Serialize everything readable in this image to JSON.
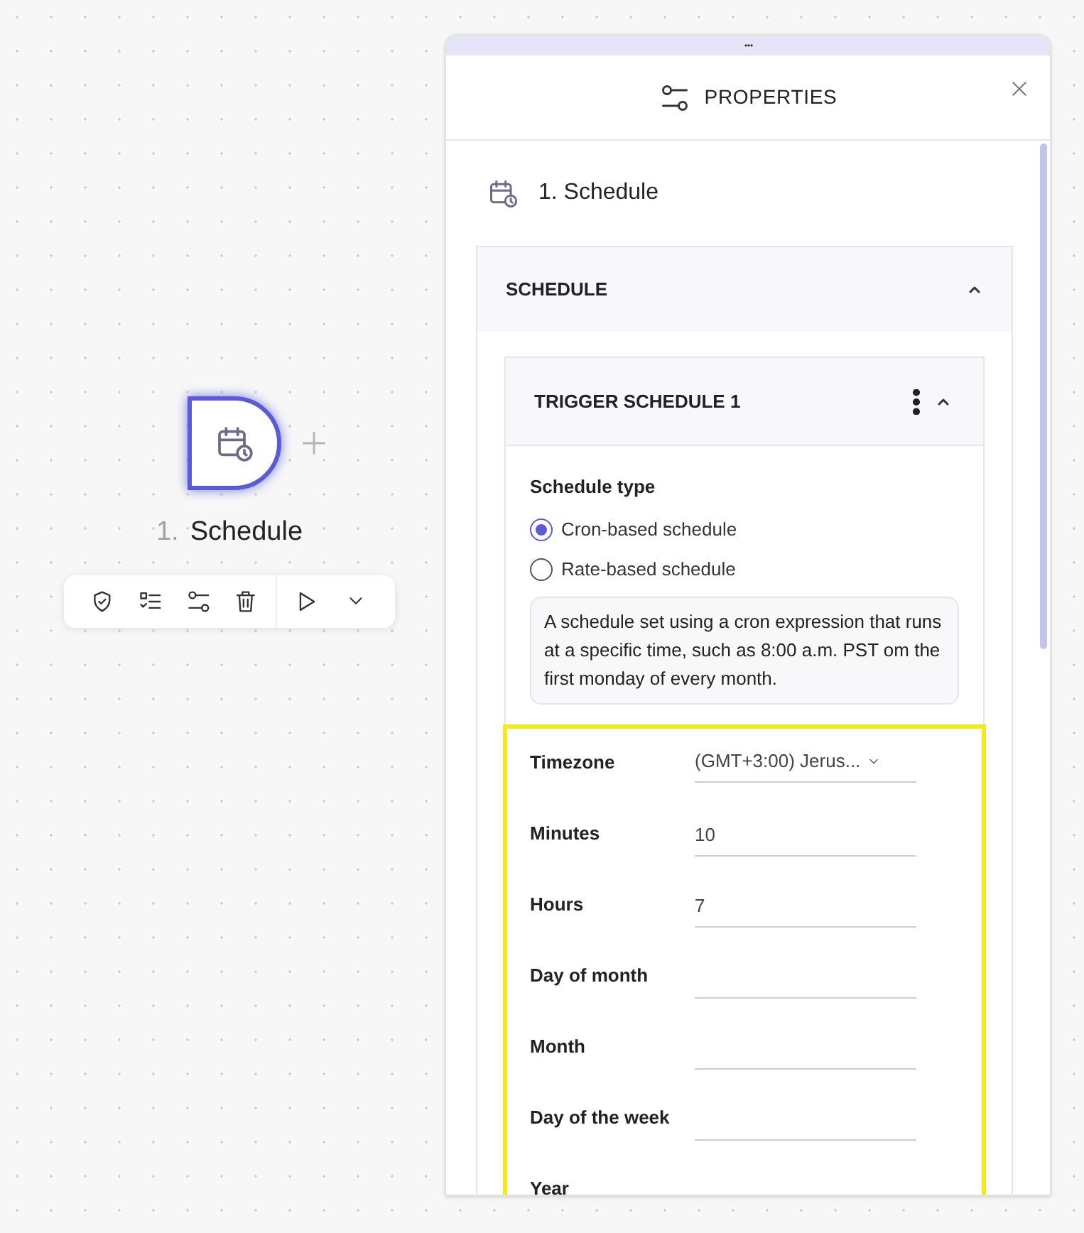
{
  "canvas": {
    "node": {
      "number": "1.",
      "title": "Schedule",
      "selected": true
    }
  },
  "properties_panel": {
    "title": "PROPERTIES",
    "step_title": "1. Schedule",
    "section": {
      "title": "SCHEDULE",
      "expanded": true,
      "trigger": {
        "title": "TRIGGER SCHEDULE 1",
        "expanded": true,
        "schedule_type": {
          "label": "Schedule type",
          "options": [
            {
              "label": "Cron-based schedule",
              "selected": true
            },
            {
              "label": "Rate-based schedule",
              "selected": false
            }
          ]
        },
        "description": "A schedule set using a cron expression that runs at a specific time, such as 8:00 a.m. PST om the first monday of every month.",
        "fields": [
          {
            "label": "Timezone",
            "kind": "dropdown",
            "value": "(GMT+3:00) Jerus..."
          },
          {
            "label": "Minutes",
            "kind": "text",
            "value": "10"
          },
          {
            "label": "Hours",
            "kind": "text",
            "value": "7"
          },
          {
            "label": "Day of month",
            "kind": "text"
          },
          {
            "label": "Month",
            "kind": "text"
          },
          {
            "label": "Day of the week",
            "kind": "text"
          },
          {
            "label": "Year",
            "kind": "label"
          }
        ]
      }
    }
  }
}
